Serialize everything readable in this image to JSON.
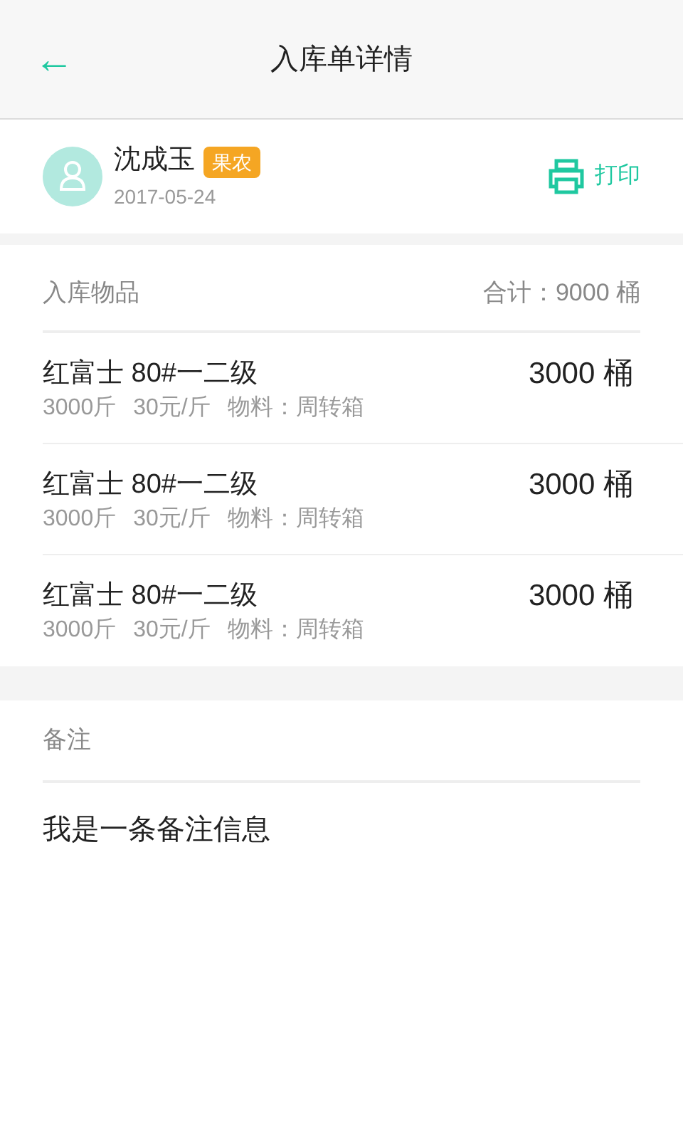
{
  "header": {
    "back": "←",
    "title": "入库单详情"
  },
  "user": {
    "name": "沈成玉",
    "tag": "果农",
    "date": "2017-05-24",
    "print_label": "打印"
  },
  "items_section": {
    "title": "入库物品",
    "total": "合计：9000 桶",
    "items": [
      {
        "name": "红富士 80#一二级",
        "quantity": "3000 桶",
        "details": [
          "3000斤",
          "30元/斤",
          "物料：周转箱"
        ]
      },
      {
        "name": "红富士 80#一二级",
        "quantity": "3000 桶",
        "details": [
          "3000斤",
          "30元/斤",
          "物料：周转箱"
        ]
      },
      {
        "name": "红富士 80#一二级",
        "quantity": "3000 桶",
        "details": [
          "3000斤",
          "30元/斤",
          "物料：周转箱"
        ]
      }
    ]
  },
  "notes": {
    "title": "备注",
    "text": "我是一条备注信息"
  }
}
